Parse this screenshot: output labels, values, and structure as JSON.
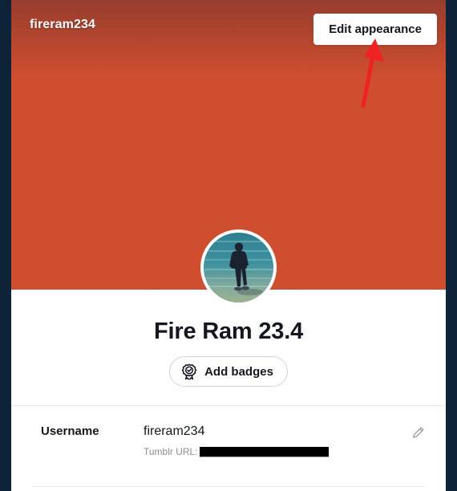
{
  "window": {
    "frame_color": "#0e2238",
    "card_background": "#ffffff"
  },
  "header": {
    "username_handle": "fireram234",
    "edit_appearance_label": "Edit appearance",
    "banner": {
      "style": "brick-wall",
      "brick_color": "#cf4e30",
      "mortar_color": "#dd6b4a"
    }
  },
  "annotation": {
    "type": "arrow",
    "color": "#ee2222",
    "points_to": "Edit appearance"
  },
  "avatar": {
    "alt": "person standing in shallow teal water",
    "border_color": "#ffffff"
  },
  "profile": {
    "display_name": "Fire Ram 23.4",
    "add_badges_label": "Add badges",
    "badge_icon": "award-rosette-check-icon"
  },
  "settings": {
    "rows": [
      {
        "label": "Username",
        "value": "fireram234",
        "sub_label": "Tumblr URL:",
        "sub_value_redacted": true,
        "edit_icon": "pencil-icon"
      }
    ]
  }
}
